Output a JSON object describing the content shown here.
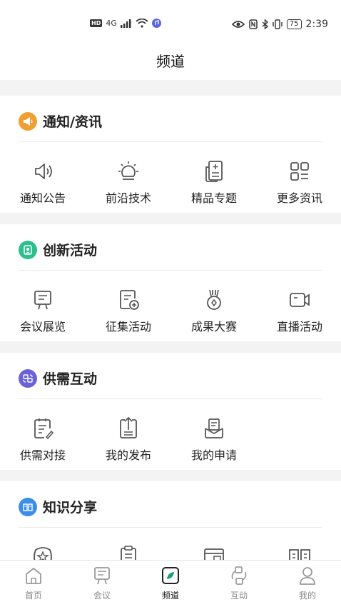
{
  "status_bar": {
    "hd": "HD",
    "network": "4G",
    "battery": "75",
    "time": "2:39"
  },
  "header": {
    "title": "频道"
  },
  "sections": [
    {
      "title": "通知/资讯",
      "badge_color": "#f0a030",
      "items": [
        {
          "label": "通知公告",
          "icon": "speaker-icon"
        },
        {
          "label": "前沿技术",
          "icon": "lightbulb-icon"
        },
        {
          "label": "精品专题",
          "icon": "document-list-icon"
        },
        {
          "label": "更多资讯",
          "icon": "grid-apps-icon"
        }
      ]
    },
    {
      "title": "创新活动",
      "badge_color": "#2fbf8f",
      "items": [
        {
          "label": "会议展览",
          "icon": "presentation-board-icon"
        },
        {
          "label": "征集活动",
          "icon": "add-document-icon"
        },
        {
          "label": "成果大赛",
          "icon": "medal-icon"
        },
        {
          "label": "直播活动",
          "icon": "video-camera-icon"
        }
      ]
    },
    {
      "title": "供需互动",
      "badge_color": "#6a63d8",
      "items": [
        {
          "label": "供需对接",
          "icon": "clipboard-edit-icon"
        },
        {
          "label": "我的发布",
          "icon": "upload-document-icon"
        },
        {
          "label": "我的申请",
          "icon": "inbox-document-icon"
        }
      ]
    },
    {
      "title": "知识分享",
      "badge_color": "#3b8de8",
      "items": [
        {
          "label": "",
          "icon": "star-badge-icon"
        },
        {
          "label": "",
          "icon": "clipboard-icon"
        },
        {
          "label": "",
          "icon": "window-icon"
        },
        {
          "label": "",
          "icon": "open-book-icon"
        }
      ]
    }
  ],
  "tab_bar": {
    "active": "频道",
    "items": [
      {
        "label": "首页",
        "icon": "home-icon"
      },
      {
        "label": "会议",
        "icon": "presentation-icon"
      },
      {
        "label": "频道",
        "icon": "channel-icon"
      },
      {
        "label": "互动",
        "icon": "exchange-icon"
      },
      {
        "label": "我的",
        "icon": "user-icon"
      }
    ]
  },
  "colors": {
    "accent_green": "#1f9e6e",
    "icon_gray": "#555555"
  }
}
